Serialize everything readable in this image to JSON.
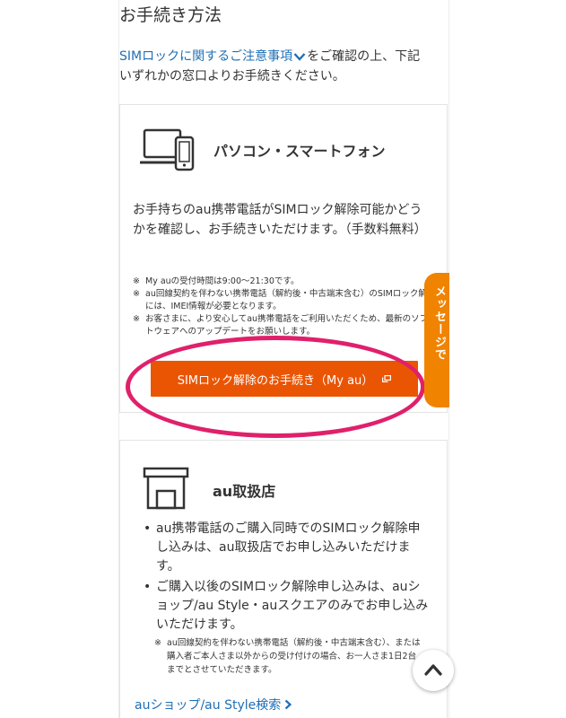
{
  "section_title": "お手続き方法",
  "intro": {
    "link_text": "SIMロックに関するご注意事項",
    "text_after": "をご確認の上、下記",
    "line2": "いずれかの窓口よりお手続きください。"
  },
  "pc_card": {
    "title": "パソコン・スマートフォン",
    "description": "お手持ちのau携帯電話がSIMロック解除可能かどうかを確認し、お手続きいただけます。（手数料無料）",
    "notes": [
      "My auの受付時間は9:00～21:30です。",
      "au回線契約を伴わない携帯電話（解約後・中古端末含む）のSIMロック解除には、IMEI情報が必要となります。",
      "お客さまに、より安心してau携帯電話をご利用いただくため、最新のソフトウェアへのアップデートをお願いします。"
    ],
    "note_mark": "※",
    "button_label": "SIMロック解除のお手続き（My au）"
  },
  "store_card": {
    "title": "au取扱店",
    "bullets": [
      "au携帯電話のご購入同時でのSIMロック解除申し込みは、au取扱店でお申し込みいただけます。",
      "ご購入以後のSIMロック解除申し込みは、auショップ/au Style・auスクエアのみでお申し込みいただけます。"
    ],
    "note": "au回線契約を伴わない携帯電話（解約後・中古端末含む）、または購入者ご本人さま以外からの受け付けの場合、お一人さま1日2台までとさせていただきます。",
    "note_mark": "※",
    "search_link": "auショップ/au Style検索"
  },
  "side_tab_label": "メッセージで",
  "colors": {
    "primary_orange": "#ea5504",
    "tab_orange": "#f08300",
    "link_blue": "#1f6fb5",
    "highlight_pink": "#e0206b"
  },
  "icons": {
    "device": "pc-smartphone-icon",
    "store": "store-icon",
    "external": "external-link-icon",
    "chevron_down": "chevron-down-icon",
    "chevron_right": "chevron-right-icon",
    "scroll_top": "chevron-up-icon"
  }
}
